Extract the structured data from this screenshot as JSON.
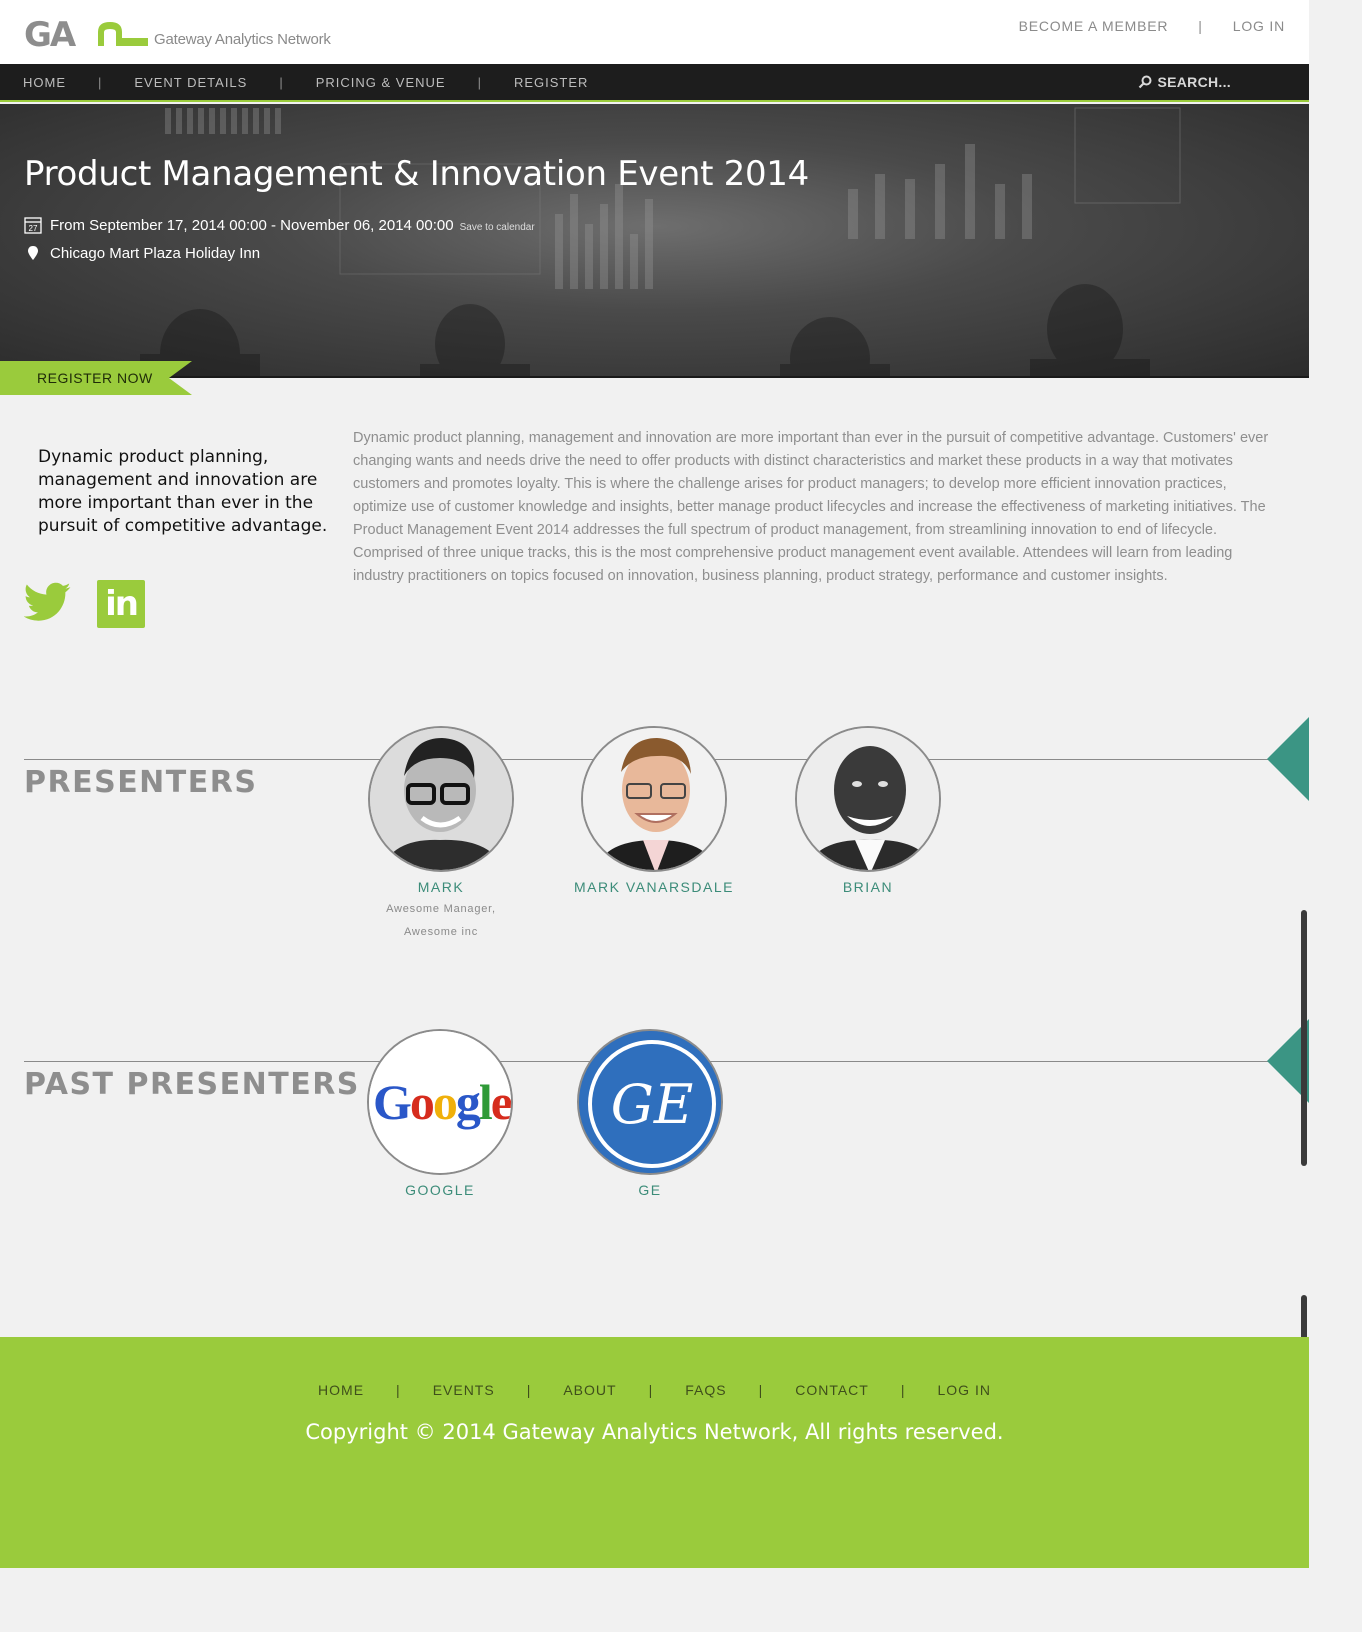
{
  "header": {
    "logo_mark": "GAN",
    "logo_text": "Gateway Analytics Network",
    "become_member": "BECOME A MEMBER",
    "separator": "|",
    "login": "LOG IN"
  },
  "nav": {
    "items": [
      {
        "label": "HOME"
      },
      {
        "label": "EVENT DETAILS"
      },
      {
        "label": "PRICING & VENUE"
      },
      {
        "label": "REGISTER"
      }
    ],
    "separator": "|",
    "search_label": "SEARCH..."
  },
  "hero": {
    "title": "Product Management & Innovation Event 2014",
    "calendar_day": "27",
    "dates": "From September 17, 2014 00:00 - November 06, 2014 00:00",
    "save_to_calendar": "Save to calendar",
    "location": "Chicago Mart Plaza Holiday Inn",
    "register_now": "REGISTER NOW"
  },
  "intro": {
    "lead": "Dynamic product planning, management and innovation are more important than ever in the pursuit of competitive advantage.",
    "body": "Dynamic product planning, management and innovation are more important than ever in the pursuit of competitive advantage.  Customers' ever changing wants and needs drive the need to offer products with distinct characteristics and market these products in a way that motivates customers and promotes loyalty.  This is where the challenge arises for product managers; to  develop more efficient innovation practices, optimize use of customer knowledge and insights, better manage product lifecycles and increase the effectiveness of marketing initiatives.  The Product Management Event 2014 addresses the full spectrum of product management, from streamlining innovation to end of lifecycle.  Comprised of three unique tracks, this is the most comprehensive product management event available.  Attendees will learn from leading industry practitioners on topics focused on innovation, business planning, product strategy, performance and customer insights.",
    "social": [
      {
        "icon": "twitter-icon"
      },
      {
        "icon": "linkedin-icon",
        "glyph": "in"
      }
    ]
  },
  "presenters": {
    "title": "PRESENTERS",
    "items": [
      {
        "name": "MARK",
        "role_line1": "Awesome Manager,",
        "role_line2": "Awesome inc"
      },
      {
        "name": "MARK VANARSDALE"
      },
      {
        "name": "BRIAN"
      }
    ]
  },
  "past_presenters": {
    "title": "PAST PRESENTERS",
    "items": [
      {
        "name": "GOOGLE",
        "logo_text": "Google"
      },
      {
        "name": "GE",
        "logo_text": "GE"
      }
    ]
  },
  "footer": {
    "links": [
      {
        "label": "HOME"
      },
      {
        "label": "EVENTS"
      },
      {
        "label": "ABOUT"
      },
      {
        "label": "FAQS"
      },
      {
        "label": "CONTACT"
      },
      {
        "label": "LOG IN"
      }
    ],
    "separator": "|",
    "copyright": "Copyright © 2014 Gateway Analytics Network, All rights reserved."
  },
  "colors": {
    "accent_green": "#9acb3c",
    "teal": "#3c8c79",
    "nav_dark": "#1d1d1d"
  }
}
